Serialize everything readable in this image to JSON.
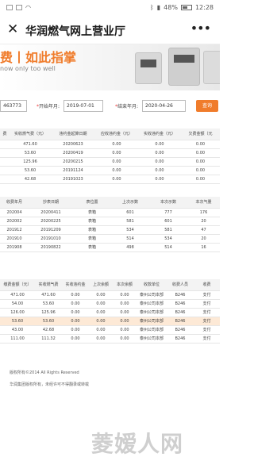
{
  "status_bar": {
    "battery": "48%",
    "time": "12:28"
  },
  "app_bar": {
    "title": "华润燃气网上营业厅"
  },
  "banner": {
    "headline": "费丨如此指掌",
    "subline": "now only too well"
  },
  "filter": {
    "account_value": "463773",
    "start_label": "开始年月:",
    "start_value": "2019-07-01",
    "end_label": "结束年月:",
    "end_value": "2020-04-26",
    "query_label": "查询",
    "required_mark": "*"
  },
  "table1": {
    "headers": [
      "费",
      "实收燃气费（元）",
      "违约金起算日期",
      "应收违约金（元）",
      "实收违约金（元）",
      "欠费金额（元"
    ],
    "rows": [
      [
        "",
        "471.60",
        "20200623",
        "0.00",
        "0.00",
        "0.00"
      ],
      [
        "",
        "53.60",
        "20200419",
        "0.00",
        "0.00",
        "0.00"
      ],
      [
        "",
        "125.96",
        "20200215",
        "0.00",
        "0.00",
        "0.00"
      ],
      [
        "",
        "53.60",
        "20191124",
        "0.00",
        "0.00",
        "0.00"
      ],
      [
        "",
        "42.68",
        "20191023",
        "0.00",
        "0.00",
        "0.00"
      ]
    ]
  },
  "table2": {
    "headers": [
      "收费年月",
      "抄表日期",
      "表位置",
      "上次示数",
      "本次示数",
      "本次气量"
    ],
    "rows": [
      [
        "202004",
        "20200411",
        "表箱",
        "601",
        "777",
        "176"
      ],
      [
        "202002",
        "20200225",
        "表箱",
        "581",
        "601",
        "20"
      ],
      [
        "201912",
        "20191209",
        "表箱",
        "534",
        "581",
        "47"
      ],
      [
        "201910",
        "20191010",
        "表箱",
        "514",
        "534",
        "20"
      ],
      [
        "201908",
        "20190822",
        "表箱",
        "498",
        "514",
        "16"
      ]
    ]
  },
  "table3": {
    "headers": [
      "缴费金额（元）",
      "实收燃气费",
      "实收违约金",
      "上次余额",
      "本次余额",
      "收款单位",
      "收费人员",
      "收费"
    ],
    "rows": [
      [
        "471.00",
        "471.60",
        "0.00",
        "0.00",
        "0.00",
        "泰州公司本部",
        "B246",
        "支付"
      ],
      [
        "54.00",
        "53.60",
        "0.00",
        "0.00",
        "0.00",
        "泰州公司本部",
        "B246",
        "支付"
      ],
      [
        "126.00",
        "125.96",
        "0.00",
        "0.00",
        "0.00",
        "泰州公司本部",
        "B246",
        "支付"
      ],
      [
        "53.60",
        "53.60",
        "0.00",
        "0.00",
        "0.00",
        "泰州公司本部",
        "B246",
        "支付"
      ],
      [
        "43.00",
        "42.68",
        "0.00",
        "0.00",
        "0.00",
        "泰州公司本部",
        "B246",
        "支付"
      ],
      [
        "111.00",
        "111.32",
        "0.00",
        "0.00",
        "0.00",
        "泰州公司本部",
        "B246",
        "支付"
      ]
    ],
    "highlight_row": 3
  },
  "footer": {
    "copyright": "版权所有©2014 All Rights Reserved",
    "notice": "华润集团版权所有，未经许可不得翻录或转载"
  },
  "watermark": "菱嫒人网",
  "colors": {
    "accent": "#f07c2b",
    "highlight_row": "#fde9d6"
  }
}
